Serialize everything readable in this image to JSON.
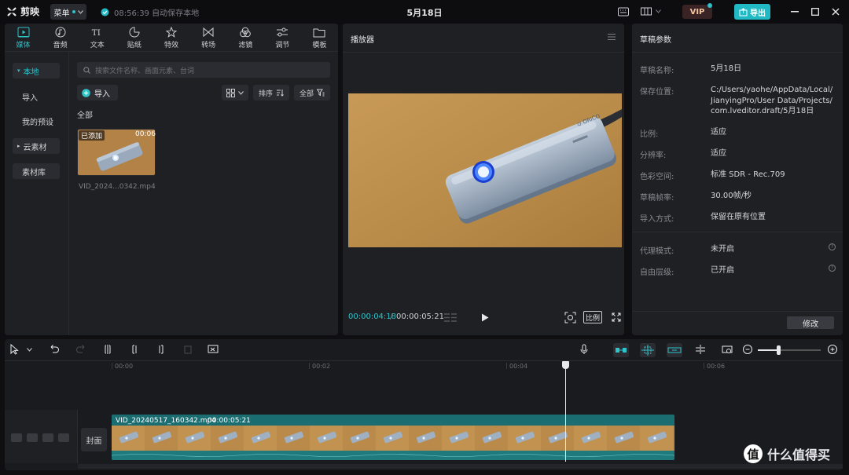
{
  "app": {
    "name": "剪映",
    "menu_label": "菜单",
    "save_status": "08:56:39 自动保存本地",
    "doc_title": "5月18日",
    "vip_label": "VIP",
    "export_label": "导出"
  },
  "media": {
    "tabs": [
      {
        "label": "媒体",
        "icon": "media-icon"
      },
      {
        "label": "音频",
        "icon": "audio-icon"
      },
      {
        "label": "文本",
        "icon": "text-icon"
      },
      {
        "label": "贴纸",
        "icon": "sticker-icon"
      },
      {
        "label": "特效",
        "icon": "effects-icon"
      },
      {
        "label": "转场",
        "icon": "transition-icon"
      },
      {
        "label": "滤镜",
        "icon": "filter-icon"
      },
      {
        "label": "调节",
        "icon": "adjust-icon"
      },
      {
        "label": "模板",
        "icon": "template-icon"
      }
    ],
    "sidebar": {
      "local": "本地",
      "import": "导入",
      "presets": "我的预设",
      "cloud": "云素材",
      "library": "素材库"
    },
    "search_placeholder": "搜索文件名称、画面元素、台词",
    "import_button": "导入",
    "sort_label": "排序",
    "filter_label": "全部",
    "section_label": "全部",
    "item": {
      "badge": "已添加",
      "duration": "00:06",
      "name": "VID_2024...0342.mp4"
    }
  },
  "player": {
    "title": "播放器",
    "current_time": "00:00:04:18",
    "separator": "/",
    "total_time": "00:00:05:21",
    "ratio_label": "比例"
  },
  "props": {
    "title": "草稿参数",
    "rows": [
      {
        "label": "草稿名称:",
        "value": "5月18日"
      },
      {
        "label": "保存位置:",
        "value": "C:/Users/yaohe/AppData/Local/\nJianyingPro/User Data/Projects/\ncom.lveditor.draft/5月18日"
      },
      {
        "label": "比例:",
        "value": "适应"
      },
      {
        "label": "分辨率:",
        "value": "适应"
      },
      {
        "label": "色彩空间:",
        "value": "标准 SDR - Rec.709"
      },
      {
        "label": "草稿帧率:",
        "value": "30.00帧/秒"
      },
      {
        "label": "导入方式:",
        "value": "保留在原有位置"
      }
    ],
    "proxy": {
      "label": "代理模式:",
      "value": "未开启"
    },
    "layer": {
      "label": "自由层级:",
      "value": "已开启"
    },
    "modify_button": "修改"
  },
  "timeline": {
    "ruler": [
      "00:00",
      "00:02",
      "00:04",
      "00:06"
    ],
    "cover_label": "封面",
    "clip_name": "VID_20240517_160342.mp4",
    "clip_duration": "00:00:05:21",
    "zoom_level": 0.33
  },
  "watermark": {
    "mark": "值",
    "text": "什么值得买"
  }
}
